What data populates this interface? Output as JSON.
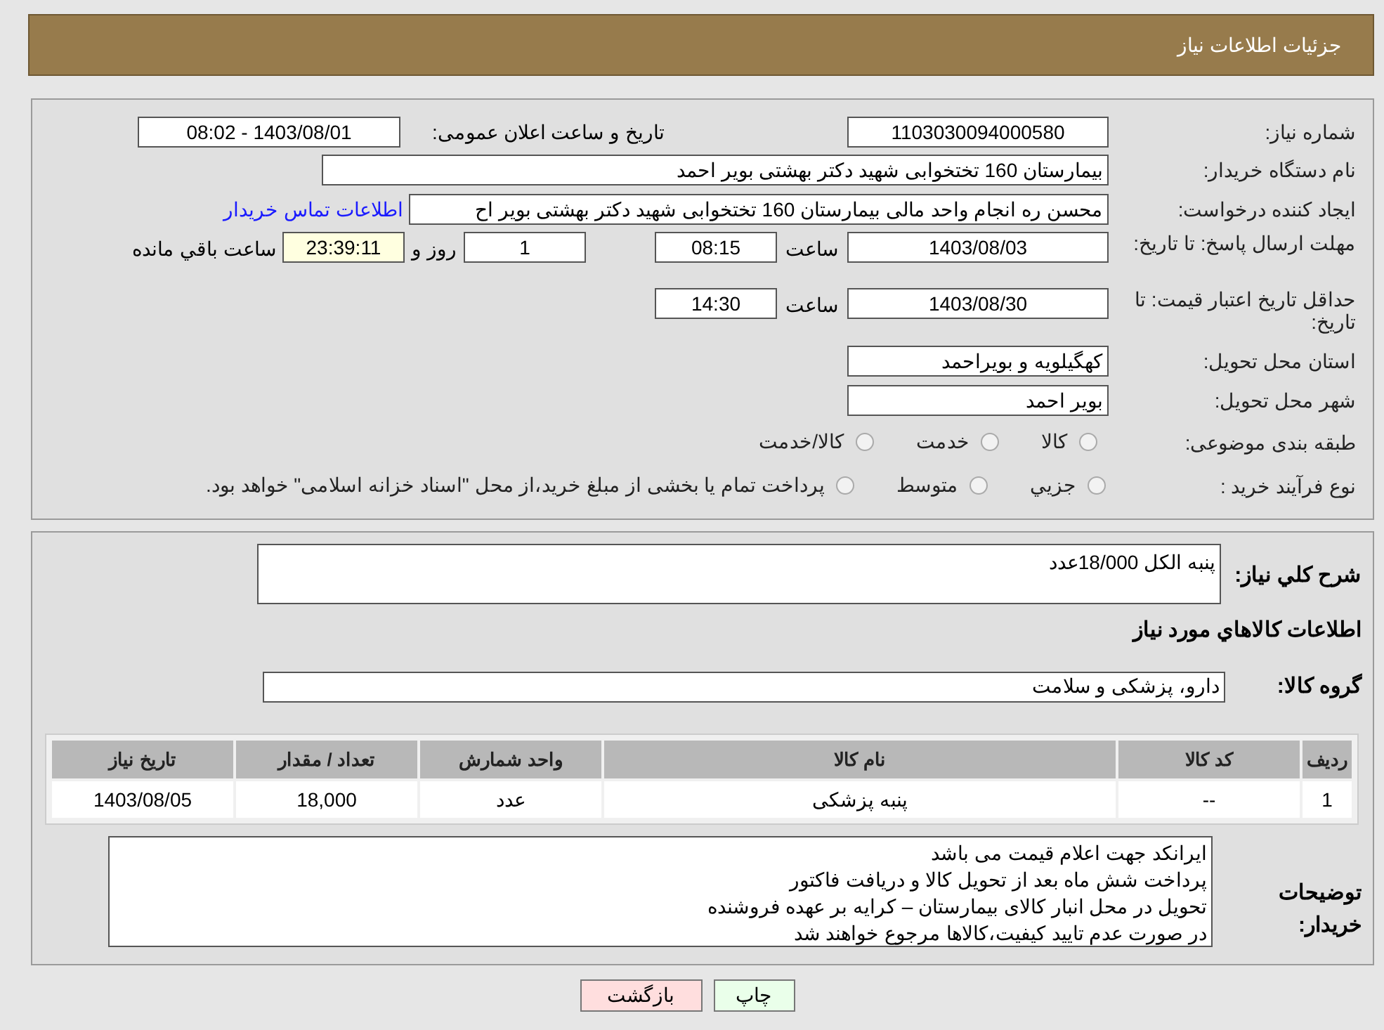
{
  "header": {
    "title": "جزئیات اطلاعات نیاز"
  },
  "need_number": {
    "label": "شماره نیاز:",
    "value": "1103030094000580"
  },
  "announce": {
    "label": "تاریخ و ساعت اعلان عمومی:",
    "value": "1403/08/01 - 08:02"
  },
  "buyer": {
    "label": "نام دستگاه خریدار:",
    "value": "بیمارستان 160 تختخوابی شهید دکتر بهشتی بویر احمد"
  },
  "requester": {
    "label": "ایجاد کننده درخواست:",
    "value": "محسن ره انجام واحد مالی بیمارستان 160 تختخوابی شهید دکتر بهشتی بویر اح",
    "link": "اطلاعات تماس خریدار"
  },
  "reply_deadline": {
    "label": "مهلت ارسال پاسخ: تا تاریخ:",
    "date": "1403/08/03",
    "time_label": "ساعت",
    "time": "08:15",
    "days": "1",
    "days_label": "روز و",
    "remaining": "23:39:11",
    "remaining_label": "ساعت باقي مانده"
  },
  "price_validity": {
    "label": "حداقل تاریخ اعتبار قیمت: تا تاریخ:",
    "date": "1403/08/30",
    "time_label": "ساعت",
    "time": "14:30"
  },
  "province": {
    "label": "استان محل تحویل:",
    "value": "کهگیلویه و بویراحمد"
  },
  "city": {
    "label": "شهر محل تحویل:",
    "value": "بویر احمد"
  },
  "category": {
    "label": "طبقه بندی موضوعی:",
    "options": [
      {
        "label": "کالا",
        "selected": false
      },
      {
        "label": "خدمت",
        "selected": false
      },
      {
        "label": "کالا/خدمت",
        "selected": false
      }
    ]
  },
  "purchase_type": {
    "label": "نوع فرآیند خرید :",
    "options": [
      {
        "label": "جزيي",
        "selected": false
      },
      {
        "label": "متوسط",
        "selected": false
      },
      {
        "label": "پرداخت تمام یا بخشی از مبلغ خرید،از محل \"اسناد خزانه اسلامی\" خواهد بود.",
        "selected": false
      }
    ]
  },
  "description": {
    "label": "شرح کلي نياز:",
    "value": "پنبه الکل 18/000عدد"
  },
  "items_title": "اطلاعات کالاهاي مورد نياز",
  "goods_group": {
    "label": "گروه کالا:",
    "value": "دارو، پزشکی و سلامت"
  },
  "table": {
    "columns": [
      "ردیف",
      "کد کالا",
      "نام کالا",
      "واحد شمارش",
      "تعداد / مقدار",
      "تاریخ نیاز"
    ],
    "rows": [
      [
        "1",
        "--",
        "پنبه پزشکی",
        "عدد",
        "18,000",
        "1403/08/05"
      ]
    ]
  },
  "buyer_notes": {
    "label": "توضیحات خریدار:",
    "lines": [
      "ایرانکد جهت اعلام قیمت می باشد",
      "پرداخت شش ماه بعد از تحویل کالا و دریافت فاکتور",
      "تحویل در محل انبار کالای بیمارستان – کرایه بر عهده فروشنده",
      "در صورت عدم تایید کیفیت،کالاها مرجوع خواهند شد"
    ]
  },
  "buttons": [
    {
      "label": "چاپ",
      "kind": "print"
    },
    {
      "label": "بازگشت",
      "kind": "back"
    }
  ]
}
